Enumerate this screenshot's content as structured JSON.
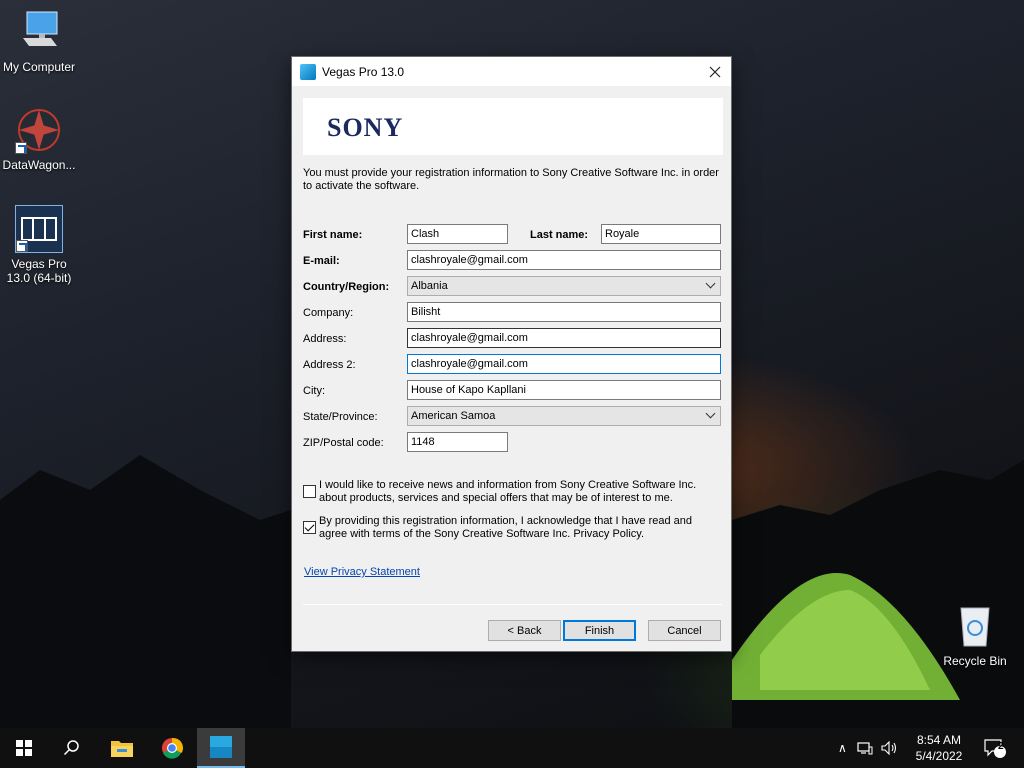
{
  "desktop": {
    "icons": [
      {
        "label": "My Computer",
        "icon": "computer-icon"
      },
      {
        "label": "DataWagon...",
        "icon": "datawagon-icon"
      },
      {
        "label_line1": "Vegas Pro",
        "label_line2": "13.0 (64-bit)",
        "icon": "vegas-pro-icon"
      },
      {
        "label": "Recycle Bin",
        "icon": "recycle-bin-icon"
      }
    ]
  },
  "dialog": {
    "title": "Vegas Pro 13.0",
    "brand": "SONY",
    "intro": "You must provide your registration information to Sony Creative Software Inc. in order to activate the software.",
    "fields": {
      "first_name": {
        "label": "First name:",
        "value": "Clash"
      },
      "last_name": {
        "label": "Last name:",
        "value": "Royale"
      },
      "email": {
        "label": "E-mail:",
        "value": "clashroyale@gmail.com"
      },
      "country": {
        "label": "Country/Region:",
        "value": "Albania"
      },
      "company": {
        "label": "Company:",
        "value": "Bilisht"
      },
      "address": {
        "label": "Address:",
        "value": "clashroyale@gmail.com"
      },
      "address2": {
        "label": "Address 2:",
        "value": "clashroyale@gmail.com"
      },
      "city": {
        "label": "City:",
        "value": "House of Kapo Kapllani"
      },
      "state": {
        "label": "State/Province:",
        "value": "American Samoa"
      },
      "zip": {
        "label": "ZIP/Postal code:",
        "value": "1148"
      }
    },
    "checkboxes": {
      "news": {
        "text": "I would like to receive news and information from Sony Creative Software Inc. about products, services and special offers that may be of interest to me.",
        "checked": false
      },
      "privacy": {
        "text": "By providing this registration information, I acknowledge that I have read and agree with terms of the Sony Creative Software Inc. Privacy Policy.",
        "checked": true
      }
    },
    "privacy_link": "View Privacy Statement",
    "buttons": {
      "back": "< Back",
      "finish": "Finish",
      "cancel": "Cancel"
    }
  },
  "taskbar": {
    "time": "8:54 AM",
    "date": "5/4/2022",
    "notification_count": "2",
    "apps": [
      "start-icon",
      "search-icon",
      "file-explorer-icon",
      "chrome-icon",
      "vegas-pro-icon"
    ]
  }
}
